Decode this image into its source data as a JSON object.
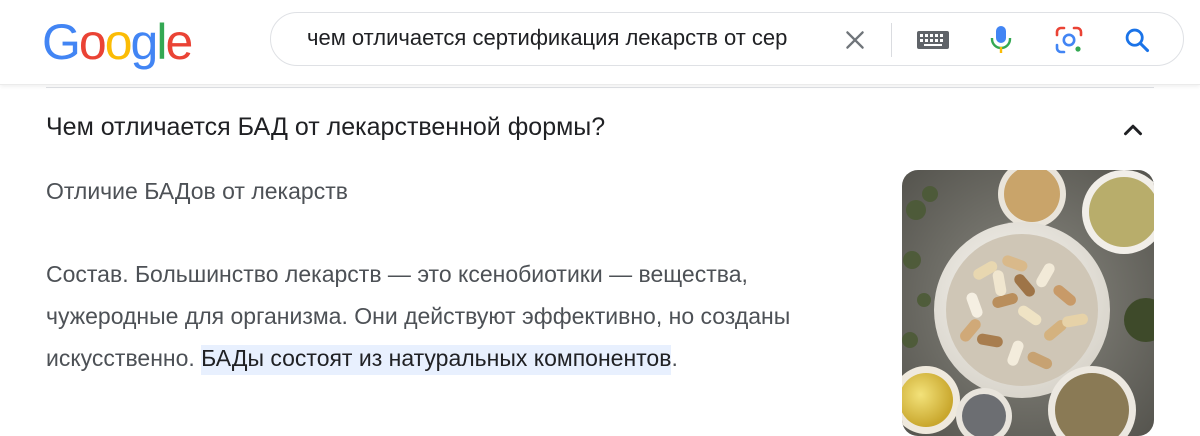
{
  "search": {
    "query": "чем отличается сертификация лекарств от сер",
    "clear_label": "×"
  },
  "logo": {
    "letters": [
      "G",
      "o",
      "o",
      "g",
      "l",
      "e"
    ],
    "colors": [
      "#4285F4",
      "#EA4335",
      "#FBBC05",
      "#4285F4",
      "#34A853",
      "#EA4335"
    ]
  },
  "accordion": {
    "question": "Чем отличается БАД от лекарственной формы?",
    "subheading": "Отличие БАДов от лекарств",
    "answer_plain": "Состав. Большинство лекарств — это ксенобиотики — вещества, чужеродные для организма. Они действуют эффективно, но созданы искусственно. ",
    "answer_highlight": "БАДы состоят из натуральных компонентов",
    "answer_end": "."
  },
  "colors": {
    "search_icon": "#1a73e8",
    "highlight": "#e8f0fe"
  }
}
